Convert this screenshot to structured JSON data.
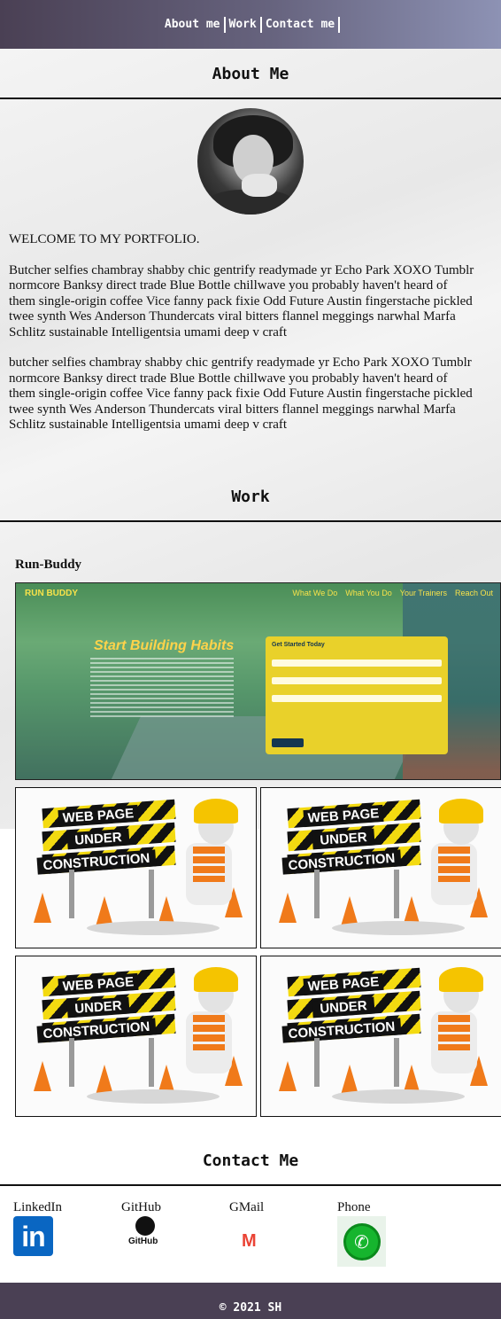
{
  "nav": {
    "items": [
      "About me",
      "Work",
      "Contact me"
    ]
  },
  "about": {
    "title": "About Me",
    "welcome": "WELCOME TO MY PORTFOLIO.",
    "para1_lines": [
      "Butcher selfies chambray shabby chic gentrify readymade yr Echo Park XOXO Tumblr",
      "normcore Banksy direct trade Blue Bottle chillwave you probably haven't heard of",
      "them single-origin coffee Vice fanny pack fixie Odd Future Austin fingerstache pickled",
      "twee synth Wes Anderson Thundercats viral bitters flannel meggings narwhal Marfa",
      "Schlitz sustainable Intelligentsia umami deep v craft"
    ],
    "para2_lines": [
      "butcher selfies chambray shabby chic gentrify readymade yr Echo Park XOXO Tumblr",
      "normcore Banksy direct trade Blue Bottle chillwave you probably haven't heard of",
      "them single-origin coffee Vice fanny pack fixie Odd Future Austin fingerstache pickled",
      "twee synth Wes Anderson Thundercats viral bitters flannel meggings narwhal Marfa",
      "Schlitz sustainable Intelligentsia umami deep v craft"
    ]
  },
  "work": {
    "title": "Work",
    "project_name": "Run-Buddy",
    "runbuddy": {
      "logo": "RUN BUDDY",
      "menu": [
        "What We Do",
        "What You Do",
        "Your Trainers",
        "Reach Out"
      ],
      "hero": "Start Building Habits",
      "form_title": "Get Started Today"
    },
    "placeholder": {
      "line1": "WEB PAGE",
      "line2": "UNDER",
      "line3": "CONSTRUCTION"
    }
  },
  "contact": {
    "title": "Contact Me",
    "items": [
      {
        "label": "LinkedIn",
        "icon": "linkedin-icon",
        "glyph": "in"
      },
      {
        "label": "GitHub",
        "icon": "github-icon",
        "glyph": "GitHub"
      },
      {
        "label": "GMail",
        "icon": "gmail-icon",
        "glyph": "M"
      },
      {
        "label": "Phone",
        "icon": "phone-icon",
        "glyph": "✆"
      }
    ]
  },
  "footer": {
    "text": "© 2021 SH"
  },
  "colors": {
    "nav_start": "#4a4054",
    "nav_end": "#8d92b4",
    "footer": "#4a4054",
    "linkedin": "#0a66c2",
    "phone": "#16b52e"
  }
}
